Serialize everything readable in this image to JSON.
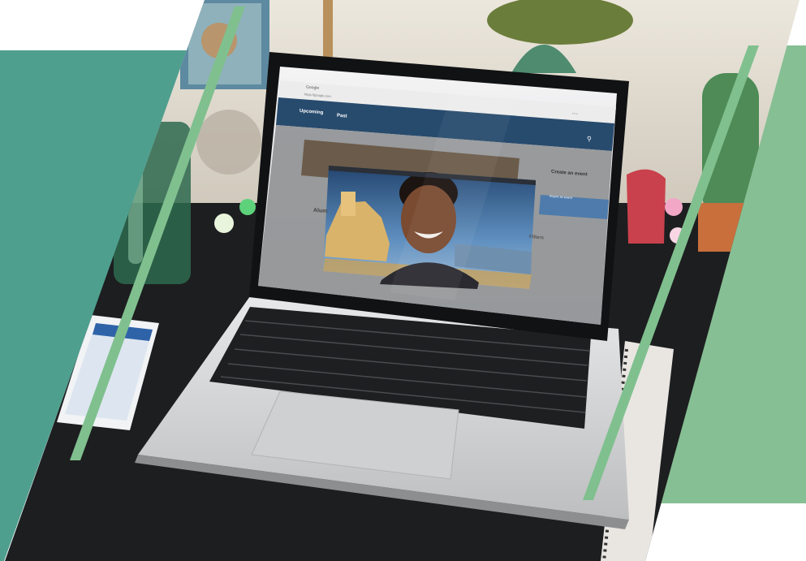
{
  "colors": {
    "teal_panel": "#4f9f8e",
    "light_green_panel": "#86bf93",
    "stripe_green": "#80c08f",
    "desk": "#1d1e20",
    "wall": "#e6e1d7",
    "laptop_body": "#d9dadb",
    "browser_header": "#274b6d",
    "video_bg": "#3b6e9e"
  },
  "laptop_screen": {
    "browser_tab_label": "Google",
    "address_text": "https://google.com",
    "nav_tab_upcoming": "Upcoming",
    "nav_tab_past": "Past",
    "side_heading": "Create an event",
    "side_button": "Import an event",
    "list_heading": "Alum",
    "side_list_heading": "Filters"
  },
  "icons": [
    "search-icon",
    "window-controls-icon"
  ]
}
